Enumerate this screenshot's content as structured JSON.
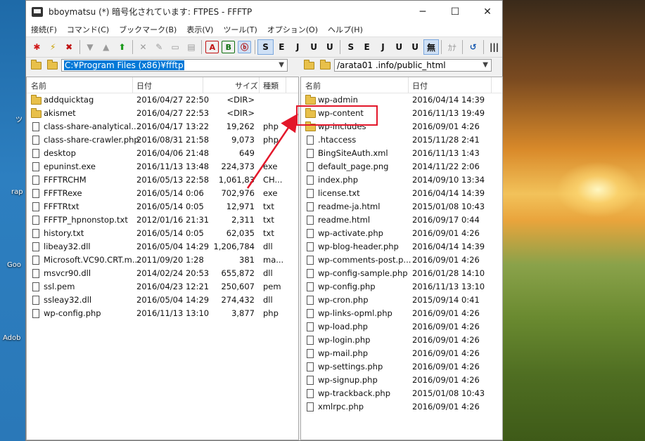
{
  "window": {
    "title": "bboymatsu (*) 暗号化されています: FTPES - FFFTP",
    "minimize": "─",
    "maximize": "☐",
    "close": "✕"
  },
  "menu": [
    "接続(F)",
    "コマンド(C)",
    "ブックマーク(B)",
    "表示(V)",
    "ツール(T)",
    "オプション(O)",
    "ヘルプ(H)"
  ],
  "toolbar": {
    "group1": [
      "✱",
      "⚡",
      "✖"
    ],
    "group2": [
      "▼",
      "▲",
      "⬆"
    ],
    "group3": [
      "✕",
      "✎",
      "▭",
      "▤"
    ],
    "transfer": [
      "A",
      "B",
      "ⓑ"
    ],
    "left_kanji": [
      "S",
      "E",
      "J",
      "U",
      "U"
    ],
    "right_kanji": [
      "S",
      "E",
      "J",
      "U",
      "U",
      "無"
    ],
    "misc": [
      "ｶﾅ",
      "↺",
      "|||"
    ]
  },
  "desktop_labels": [
    "ツ",
    "rap",
    "Goo",
    "Adob"
  ],
  "local": {
    "path": "C:¥Program Files (x86)¥ffftp",
    "headers": {
      "name": "名前",
      "date": "日付",
      "size": "サイズ",
      "type": "種類"
    },
    "files": [
      {
        "name": "addquicktag",
        "date": "2016/04/27 22:50",
        "size": "<DIR>",
        "type": "",
        "folder": true
      },
      {
        "name": "akismet",
        "date": "2016/04/27 22:53",
        "size": "<DIR>",
        "type": "",
        "folder": true
      },
      {
        "name": "class-share-analytical...",
        "date": "2016/04/17 13:22",
        "size": "19,262",
        "type": "php"
      },
      {
        "name": "class-share-crawler.php",
        "date": "2016/08/31 21:58",
        "size": "9,073",
        "type": "php"
      },
      {
        "name": "desktop",
        "date": "2016/04/06 21:48",
        "size": "649",
        "type": ""
      },
      {
        "name": "epuninst.exe",
        "date": "2016/11/13 13:48",
        "size": "224,373",
        "type": "exe"
      },
      {
        "name": "FFFTRCHM",
        "date": "2016/05/13 22:58",
        "size": "1,061,83",
        "type": "CH..."
      },
      {
        "name": "FFFTRexe",
        "date": "2016/05/14 0:06",
        "size": "702,976",
        "type": "exe"
      },
      {
        "name": "FFFTRtxt",
        "date": "2016/05/14 0:05",
        "size": "12,971",
        "type": "txt"
      },
      {
        "name": "FFFTP_hpnonstop.txt",
        "date": "2012/01/16 21:31",
        "size": "2,311",
        "type": "txt"
      },
      {
        "name": "history.txt",
        "date": "2016/05/14 0:05",
        "size": "62,035",
        "type": "txt"
      },
      {
        "name": "libeay32.dll",
        "date": "2016/05/04 14:29",
        "size": "1,206,784",
        "type": "dll"
      },
      {
        "name": "Microsoft.VC90.CRT.m...",
        "date": "2011/09/20 1:28",
        "size": "381",
        "type": "ma..."
      },
      {
        "name": "msvcr90.dll",
        "date": "2014/02/24 20:53",
        "size": "655,872",
        "type": "dll"
      },
      {
        "name": "ssl.pem",
        "date": "2016/04/23 12:21",
        "size": "250,607",
        "type": "pem"
      },
      {
        "name": "ssleay32.dll",
        "date": "2016/05/04 14:29",
        "size": "274,432",
        "type": "dll"
      },
      {
        "name": "wp-config.php",
        "date": "2016/11/13 13:10",
        "size": "3,877",
        "type": "php"
      }
    ]
  },
  "remote": {
    "path": "/arata01 .info/public_html",
    "headers": {
      "name": "名前",
      "date": "日付"
    },
    "files": [
      {
        "name": "wp-admin",
        "date": "2016/04/14 14:39",
        "folder": true
      },
      {
        "name": "wp-content",
        "date": "2016/11/13 19:49",
        "folder": true
      },
      {
        "name": "wp-includes",
        "date": "2016/09/01 4:26",
        "folder": true
      },
      {
        "name": ".htaccess",
        "date": "2015/11/28 2:41"
      },
      {
        "name": "BingSiteAuth.xml",
        "date": "2016/11/13 1:43"
      },
      {
        "name": "default_page.png",
        "date": "2014/11/22 2:06"
      },
      {
        "name": "index.php",
        "date": "2014/09/10 13:34"
      },
      {
        "name": "license.txt",
        "date": "2016/04/14 14:39"
      },
      {
        "name": "readme-ja.html",
        "date": "2015/01/08 10:43"
      },
      {
        "name": "readme.html",
        "date": "2016/09/17 0:44"
      },
      {
        "name": "wp-activate.php",
        "date": "2016/09/01 4:26"
      },
      {
        "name": "wp-blog-header.php",
        "date": "2016/04/14 14:39"
      },
      {
        "name": "wp-comments-post.p...",
        "date": "2016/09/01 4:26"
      },
      {
        "name": "wp-config-sample.php",
        "date": "2016/01/28 14:10"
      },
      {
        "name": "wp-config.php",
        "date": "2016/11/13 13:10"
      },
      {
        "name": "wp-cron.php",
        "date": "2015/09/14 0:41"
      },
      {
        "name": "wp-links-opml.php",
        "date": "2016/09/01 4:26"
      },
      {
        "name": "wp-load.php",
        "date": "2016/09/01 4:26"
      },
      {
        "name": "wp-login.php",
        "date": "2016/09/01 4:26"
      },
      {
        "name": "wp-mail.php",
        "date": "2016/09/01 4:26"
      },
      {
        "name": "wp-settings.php",
        "date": "2016/09/01 4:26"
      },
      {
        "name": "wp-signup.php",
        "date": "2016/09/01 4:26"
      },
      {
        "name": "wp-trackback.php",
        "date": "2015/01/08 10:43"
      },
      {
        "name": "xmlrpc.php",
        "date": "2016/09/01 4:26"
      }
    ]
  },
  "colors": {
    "highlight": "#e3172a",
    "selection": "#0078d7"
  }
}
